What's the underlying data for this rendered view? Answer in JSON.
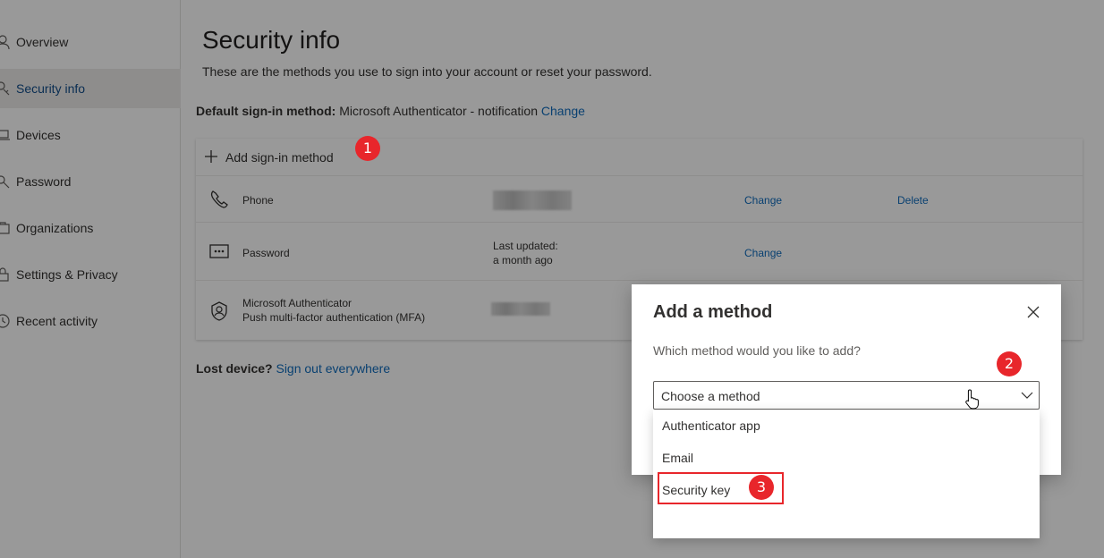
{
  "sidebar": {
    "items": [
      {
        "label": "Overview",
        "icon": "person-icon"
      },
      {
        "label": "Security info",
        "icon": "key-person-icon",
        "active": true
      },
      {
        "label": "Devices",
        "icon": "laptop-icon"
      },
      {
        "label": "Password",
        "icon": "lock-icon"
      },
      {
        "label": "Organizations",
        "icon": "briefcase-icon"
      },
      {
        "label": "Settings & Privacy",
        "icon": "lock-settings-icon"
      },
      {
        "label": "Recent activity",
        "icon": "clock-icon"
      }
    ]
  },
  "main": {
    "title": "Security info",
    "subtitle": "These are the methods you use to sign into your account or reset your password.",
    "default_label": "Default sign-in method:",
    "default_value": "Microsoft Authenticator - notification",
    "default_change": "Change",
    "add_method_label": "Add sign-in method",
    "methods": [
      {
        "name": "Phone",
        "change": "Change",
        "delete": "Delete",
        "icon": "phone-icon"
      },
      {
        "name": "Password",
        "detail_line1": "Last updated:",
        "detail_line2": "a month ago",
        "change": "Change",
        "icon": "password-dots-icon"
      },
      {
        "name": "Microsoft Authenticator",
        "name_line2": "Push multi-factor authentication (MFA)",
        "icon": "authenticator-icon"
      }
    ],
    "lost_label": "Lost device?",
    "lost_link": "Sign out everywhere"
  },
  "dialog": {
    "title": "Add a method",
    "question": "Which method would you like to add?",
    "select_value": "Choose a method",
    "options": [
      "Authenticator app",
      "Email",
      "Security key"
    ]
  },
  "annotations": {
    "step1": "1",
    "step2": "2",
    "step3": "3",
    "color": "#e8262b"
  },
  "colors": {
    "link": "#0f6cbd",
    "active_nav_bg": "#edebe9"
  }
}
